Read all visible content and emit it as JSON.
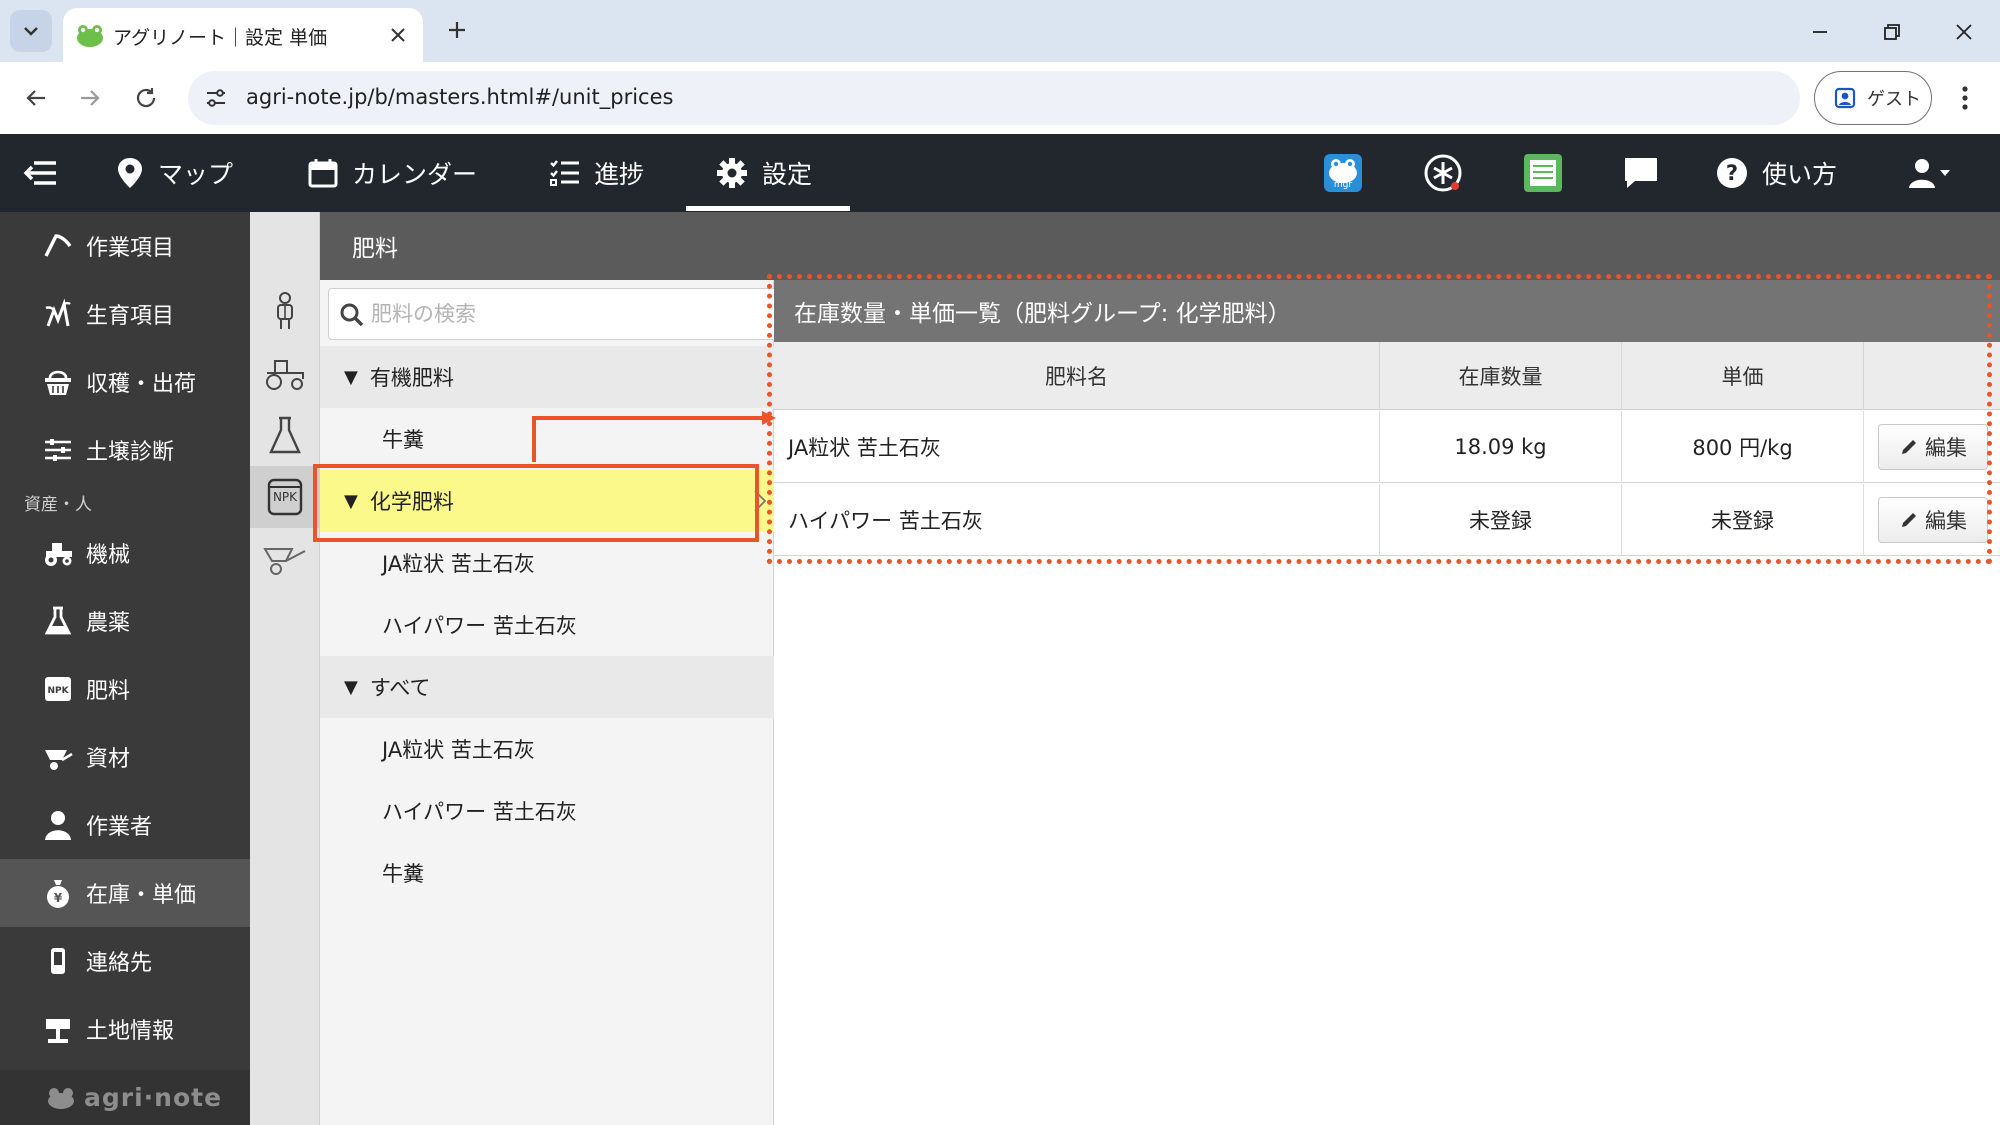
{
  "browser": {
    "tab_title": "アグリノート｜設定 単価",
    "url": "agri-note.jp/b/masters.html#/unit_prices",
    "profile_label": "ゲスト"
  },
  "header": {
    "nav": [
      {
        "label": "マップ",
        "icon": "map-pin-icon"
      },
      {
        "label": "カレンダー",
        "icon": "calendar-icon"
      },
      {
        "label": "進捗",
        "icon": "checklist-icon"
      },
      {
        "label": "設定",
        "icon": "gear-icon",
        "active": true
      }
    ],
    "help_label": "使い方"
  },
  "sidebar": {
    "items_top": [
      {
        "label": "作業項目",
        "icon": "hoe-icon"
      },
      {
        "label": "生育項目",
        "icon": "sprout-icon"
      },
      {
        "label": "収穫・出荷",
        "icon": "basket-icon"
      },
      {
        "label": "土壌診断",
        "icon": "sliders-icon"
      }
    ],
    "section_label": "資産・人",
    "items_assets": [
      {
        "label": "機械",
        "icon": "tractor-icon"
      },
      {
        "label": "農薬",
        "icon": "flask-icon"
      },
      {
        "label": "肥料",
        "icon": "npk-icon"
      },
      {
        "label": "資材",
        "icon": "wheelbarrow-icon"
      },
      {
        "label": "作業者",
        "icon": "person-icon"
      },
      {
        "label": "在庫・単価",
        "icon": "money-bag-icon",
        "active": true
      },
      {
        "label": "連絡先",
        "icon": "phone-icon"
      },
      {
        "label": "土地情報",
        "icon": "signpost-icon"
      }
    ],
    "footer_logo": "agri·note"
  },
  "rail": {
    "npk_label": "NPK"
  },
  "content": {
    "header_title": "肥料",
    "search": {
      "placeholder": "肥料の検索",
      "value": ""
    },
    "tree": [
      {
        "group": "有機肥料",
        "items": [
          "牛糞"
        ]
      },
      {
        "group": "化学肥料",
        "selected": true,
        "items": [
          "JA粒状 苦土石灰",
          "ハイパワー 苦土石灰"
        ]
      },
      {
        "group": "すべて",
        "items": [
          "JA粒状 苦土石灰",
          "ハイパワー 苦土石灰",
          "牛糞"
        ]
      }
    ],
    "table": {
      "title": "在庫数量・単価一覧（肥料グループ: 化学肥料）",
      "columns": [
        "肥料名",
        "在庫数量",
        "単価",
        ""
      ],
      "rows": [
        {
          "name": "JA粒状 苦土石灰",
          "qty": "18.09 kg",
          "price": "800 円/kg",
          "action": "編集"
        },
        {
          "name": "ハイパワー 苦土石灰",
          "qty": "未登録",
          "price": "未登録",
          "action": "編集"
        }
      ]
    }
  },
  "colors": {
    "annotation": "#e9542a",
    "selected_bg": "#fbf98a",
    "header_bg": "#21272d",
    "sidebar_bg": "#3a3a3a"
  }
}
